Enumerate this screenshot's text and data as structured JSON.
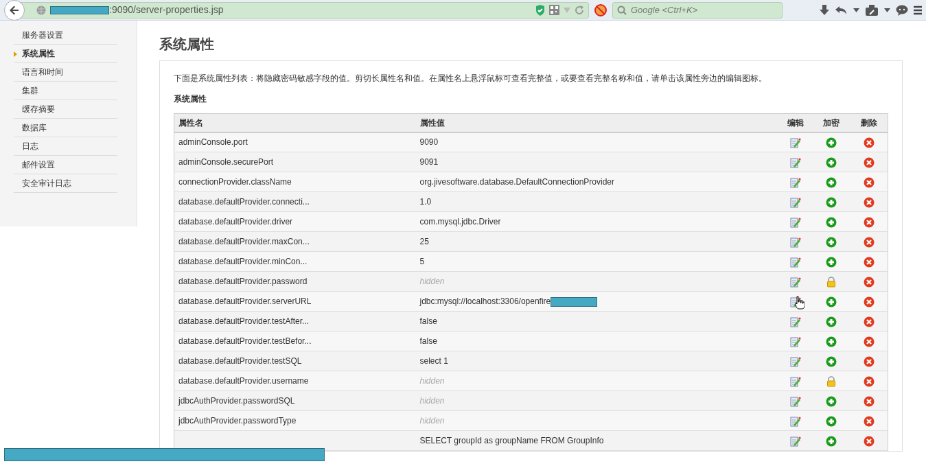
{
  "browser": {
    "url": ":9090/server-properties.jsp",
    "search_placeholder": "Google <Ctrl+K>"
  },
  "sidebar": {
    "items": [
      {
        "label": "服务器设置",
        "selected": false
      },
      {
        "label": "系统属性",
        "selected": true
      },
      {
        "label": "语言和时间",
        "selected": false
      },
      {
        "label": "集群",
        "selected": false
      },
      {
        "label": "缓存摘要",
        "selected": false
      },
      {
        "label": "数据库",
        "selected": false
      },
      {
        "label": "日志",
        "selected": false
      },
      {
        "label": "邮件设置",
        "selected": false
      },
      {
        "label": "安全审计日志",
        "selected": false
      }
    ]
  },
  "page": {
    "title": "系统属性",
    "description": "下面是系统属性列表：将隐藏密码敏感字段的值。剪切长属性名和值。在属性名上悬浮鼠标可查看完整值，或要查看完整名称和值，请单击该属性旁边的编辑图标。",
    "section_title": "系统属性"
  },
  "table": {
    "columns": [
      "属性名",
      "属性值",
      "编辑",
      "加密",
      "删除"
    ],
    "rows": [
      {
        "name": "adminConsole.port",
        "value": "9090",
        "masked": false,
        "encrypted": false
      },
      {
        "name": "adminConsole.securePort",
        "value": "9091",
        "masked": false,
        "encrypted": false
      },
      {
        "name": "connectionProvider.className",
        "value": "org.jivesoftware.database.DefaultConnectionProvider",
        "masked": false,
        "encrypted": false
      },
      {
        "name": "database.defaultProvider.connecti...",
        "value": "1.0",
        "masked": false,
        "encrypted": false
      },
      {
        "name": "database.defaultProvider.driver",
        "value": "com.mysql.jdbc.Driver",
        "masked": false,
        "encrypted": false
      },
      {
        "name": "database.defaultProvider.maxCon...",
        "value": "25",
        "masked": false,
        "encrypted": false
      },
      {
        "name": "database.defaultProvider.minCon...",
        "value": "5",
        "masked": false,
        "encrypted": false
      },
      {
        "name": "database.defaultProvider.password",
        "value": "hidden",
        "masked": true,
        "encrypted": true
      },
      {
        "name": "database.defaultProvider.serverURL",
        "value": "jdbc:mysql://localhost:3306/openfire",
        "masked": false,
        "encrypted": false,
        "redacted": true
      },
      {
        "name": "database.defaultProvider.testAfter...",
        "value": "false",
        "masked": false,
        "encrypted": false
      },
      {
        "name": "database.defaultProvider.testBefor...",
        "value": "false",
        "masked": false,
        "encrypted": false
      },
      {
        "name": "database.defaultProvider.testSQL",
        "value": "select 1",
        "masked": false,
        "encrypted": false
      },
      {
        "name": "database.defaultProvider.username",
        "value": "hidden",
        "masked": true,
        "encrypted": true
      },
      {
        "name": "jdbcAuthProvider.passwordSQL",
        "value": "hidden",
        "masked": true,
        "encrypted": false
      },
      {
        "name": "jdbcAuthProvider.passwordType",
        "value": "hidden",
        "masked": true,
        "encrypted": false
      },
      {
        "value": "SELECT groupId as groupName FROM GroupInfo",
        "masked": false,
        "encrypted": false
      }
    ]
  }
}
